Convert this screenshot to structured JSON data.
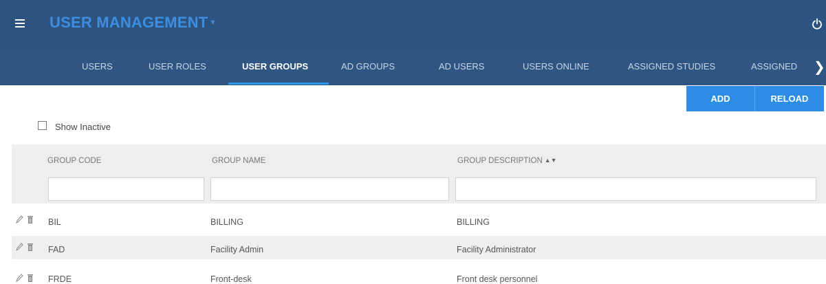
{
  "header": {
    "title": "USER MANAGEMENT",
    "title_caret": "▾"
  },
  "tabs": [
    {
      "label": "USERS",
      "active": false
    },
    {
      "label": "USER ROLES",
      "active": false
    },
    {
      "label": "USER GROUPS",
      "active": true
    },
    {
      "label": "AD GROUPS",
      "active": false
    },
    {
      "label": "AD USERS",
      "active": false
    },
    {
      "label": "USERS ONLINE",
      "active": false
    },
    {
      "label": "ASSIGNED STUDIES",
      "active": false
    },
    {
      "label": "ASSIGNED",
      "active": false
    }
  ],
  "tab_next_glyph": "❯",
  "toolbar": {
    "add_label": "ADD",
    "reload_label": "RELOAD"
  },
  "filters": {
    "show_inactive_label": "Show Inactive",
    "show_inactive_checked": false
  },
  "grid": {
    "columns": [
      {
        "label": "GROUP CODE",
        "filter_value": ""
      },
      {
        "label": "GROUP NAME",
        "filter_value": ""
      },
      {
        "label": "GROUP DESCRIPTION",
        "filter_value": "",
        "sort_glyph": "▲▼"
      }
    ],
    "rows": [
      {
        "code": "BIL",
        "name": "BILLING",
        "description": "BILLING"
      },
      {
        "code": "FAD",
        "name": "Facility Admin",
        "description": "Facility Administrator"
      },
      {
        "code": "FRDE",
        "name": "Front-desk",
        "description": "Front desk personnel"
      }
    ]
  },
  "icons": {
    "menu": "menu-icon",
    "power": "power-icon",
    "edit": "pencil-icon",
    "delete": "trash-icon"
  },
  "colors": {
    "header_bg": "#2d5381",
    "title": "#3d8ee0",
    "accent": "#2d8de5",
    "active_tab_underline": "#2f95e8"
  }
}
